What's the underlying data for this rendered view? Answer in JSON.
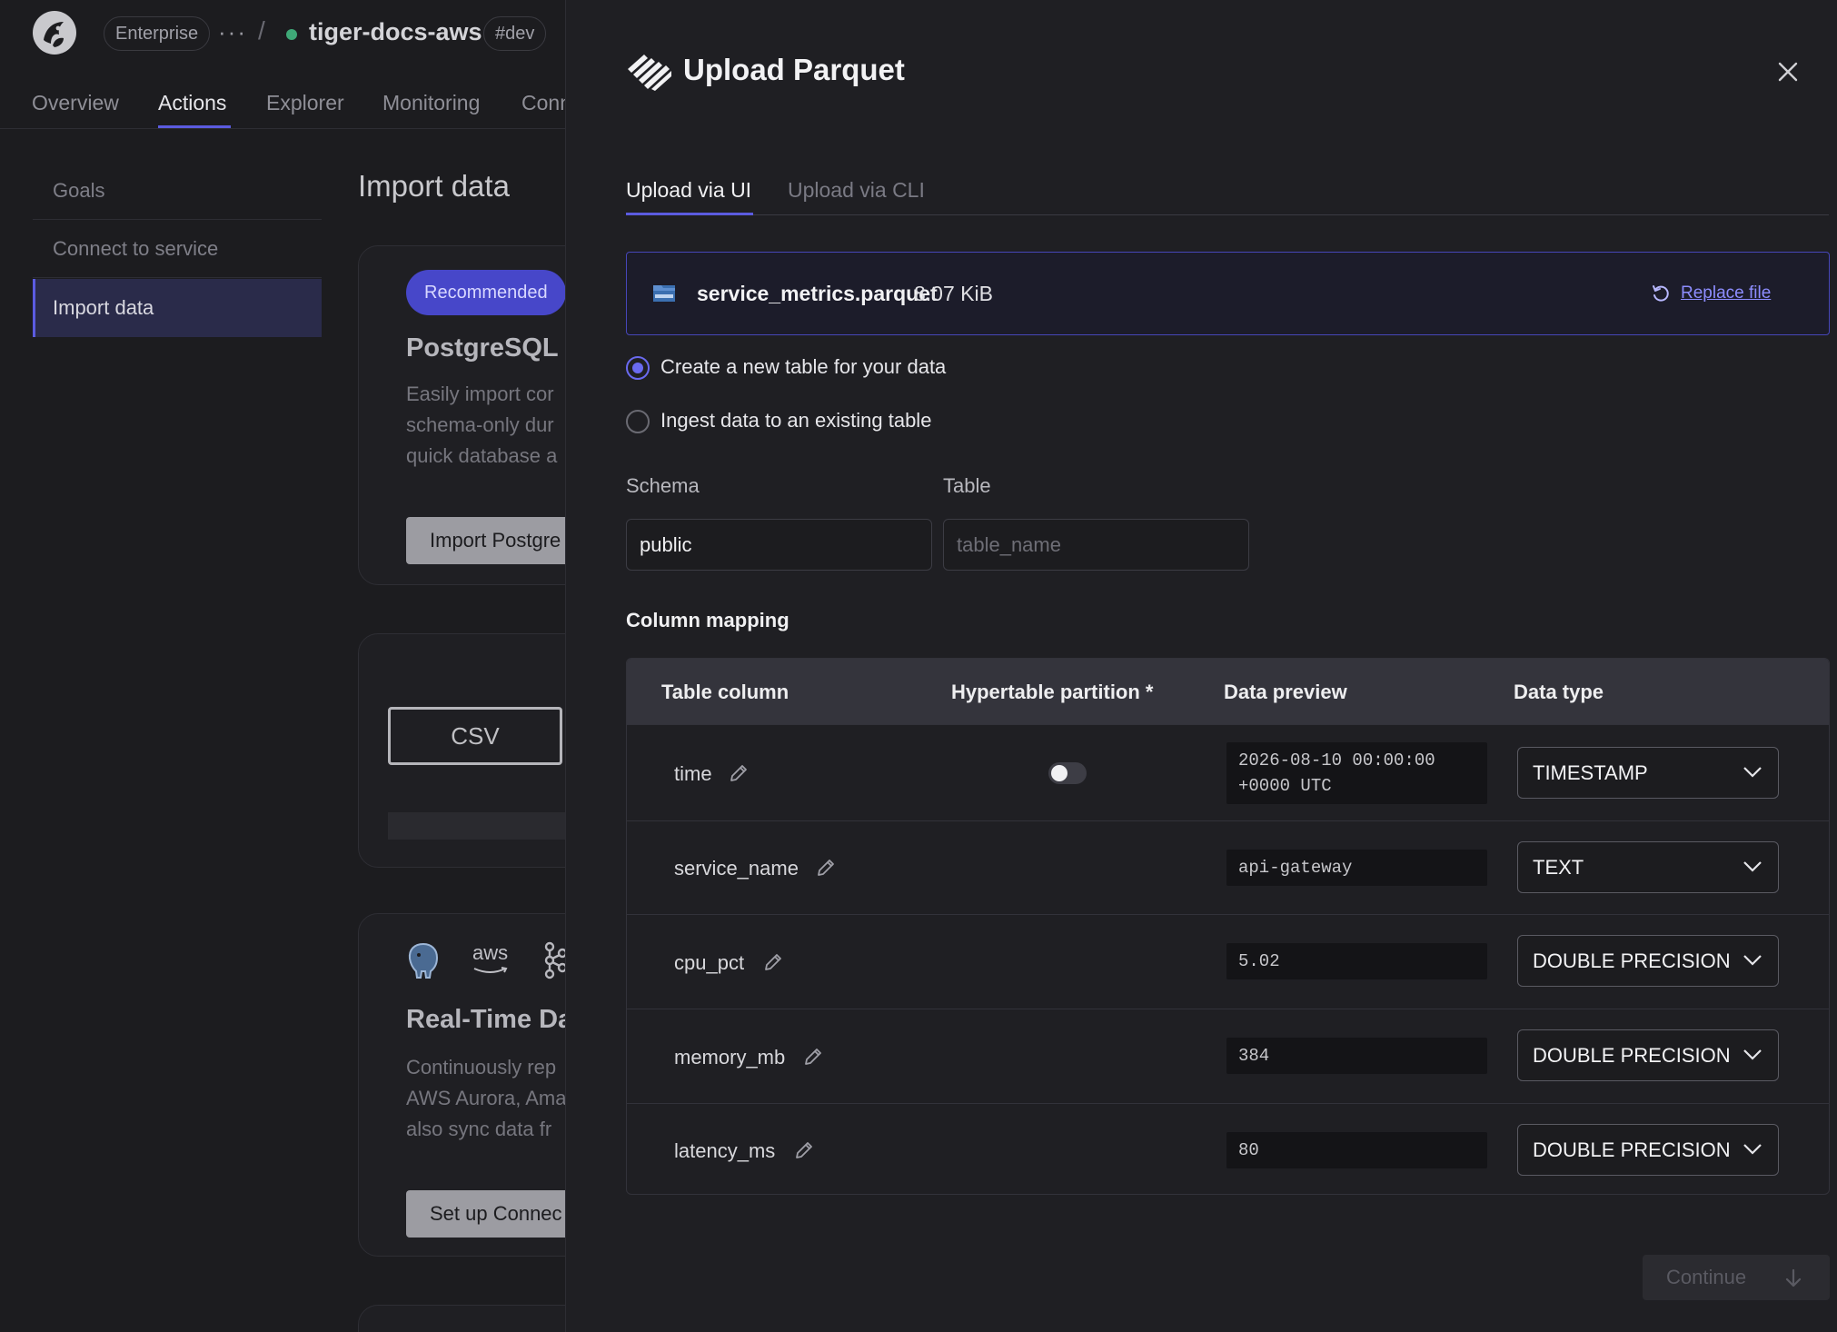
{
  "app": {
    "org_badge": "Enterprise",
    "more": "···",
    "separator": "/",
    "service_name": "tiger-docs-aws",
    "env_badge": "#dev",
    "nav": [
      {
        "label": "Overview"
      },
      {
        "label": "Actions"
      },
      {
        "label": "Explorer"
      },
      {
        "label": "Monitoring"
      },
      {
        "label": "Conn"
      }
    ],
    "sidebar": [
      {
        "label": "Goals"
      },
      {
        "label": "Connect to service"
      },
      {
        "label": "Import data"
      }
    ],
    "page_title": "Import data",
    "cards": {
      "postgres": {
        "badge": "Recommended",
        "title": "PostgreSQL I",
        "lines": [
          "Easily import cor",
          "schema-only dur",
          "quick database a"
        ],
        "button": "Import Postgre"
      },
      "csv": {
        "label": "CSV"
      },
      "realtime": {
        "aws_label": "aws",
        "title": "Real-Time Da",
        "lines": [
          "Continuously rep",
          "AWS Aurora, Ama",
          "also sync data fr"
        ],
        "button": "Set up Connec"
      }
    }
  },
  "modal": {
    "title": "Upload Parquet",
    "tabs": [
      {
        "label": "Upload via UI",
        "active": true
      },
      {
        "label": "Upload via CLI",
        "active": false
      }
    ],
    "file": {
      "name": "service_metrics.parquet",
      "size": "8.07 KiB",
      "replace_label": "Replace file"
    },
    "options": [
      {
        "label": "Create a new table for your data",
        "checked": true
      },
      {
        "label": "Ingest data to an existing table",
        "checked": false
      }
    ],
    "schema": {
      "label": "Schema",
      "value": "public"
    },
    "table": {
      "label": "Table",
      "placeholder": "table_name"
    },
    "mapping_title": "Column mapping",
    "columns_header": {
      "name": "Table column",
      "partition": "Hypertable partition *",
      "preview": "Data preview",
      "type": "Data type"
    },
    "rows": [
      {
        "name": "time",
        "preview": "2026-08-10 00:00:00 +0000 UTC",
        "type": "TIMESTAMP",
        "partition_toggle": true
      },
      {
        "name": "service_name",
        "preview": "api-gateway",
        "type": "TEXT",
        "partition_toggle": false
      },
      {
        "name": "cpu_pct",
        "preview": "5.02",
        "type": "DOUBLE PRECISION",
        "partition_toggle": false
      },
      {
        "name": "memory_mb",
        "preview": "384",
        "type": "DOUBLE PRECISION",
        "partition_toggle": false
      },
      {
        "name": "latency_ms",
        "preview": "80",
        "type": "DOUBLE PRECISION",
        "partition_toggle": false
      }
    ],
    "continue_label": "Continue"
  },
  "colors": {
    "accent": "#5b5be0",
    "link": "#8d8dff",
    "status_green": "#3fa877"
  }
}
